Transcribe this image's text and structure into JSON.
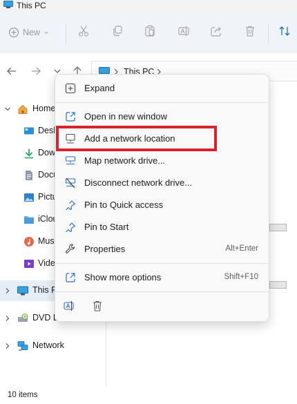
{
  "window": {
    "title": "This PC"
  },
  "command_bar": {
    "new_label": "New",
    "buttons": [
      "cut-icon",
      "copy-icon",
      "paste-icon",
      "rename-icon",
      "share-icon",
      "delete-icon",
      "sort-icon"
    ]
  },
  "navigation": {
    "breadcrumb": [
      "This PC"
    ]
  },
  "sidebar": {
    "items": [
      {
        "label": "Home",
        "icon": "home-icon"
      },
      {
        "label": "Desk",
        "icon": "desktop-folder-icon"
      },
      {
        "label": "Dow",
        "icon": "downloads-icon"
      },
      {
        "label": "Docu",
        "icon": "documents-icon"
      },
      {
        "label": "Pictu",
        "icon": "pictures-icon"
      },
      {
        "label": "iClou",
        "icon": "icloud-folder-icon"
      },
      {
        "label": "Musi",
        "icon": "music-icon"
      },
      {
        "label": "Vide",
        "icon": "videos-icon"
      },
      {
        "label": "This P",
        "icon": "this-pc-icon",
        "selected": true
      },
      {
        "label": "DVD D",
        "icon": "dvd-drive-icon"
      },
      {
        "label": "Network",
        "icon": "network-icon"
      }
    ]
  },
  "context_menu": {
    "items": [
      {
        "label": "Expand",
        "icon": "expand-icon"
      },
      {
        "label": "Open in new window",
        "icon": "open-new-window-icon"
      },
      {
        "label": "Add a network location",
        "icon": "network-location-icon",
        "highlighted": true
      },
      {
        "label": "Map network drive...",
        "icon": "map-network-drive-icon"
      },
      {
        "label": "Disconnect network drive...",
        "icon": "disconnect-drive-icon"
      },
      {
        "label": "Pin to Quick access",
        "icon": "pin-icon"
      },
      {
        "label": "Pin to Start",
        "icon": "pin-icon"
      },
      {
        "label": "Properties",
        "icon": "properties-icon",
        "shortcut": "Alt+Enter"
      },
      {
        "label": "Show more options",
        "icon": "show-more-options-icon",
        "shortcut": "Shift+F10"
      }
    ],
    "bottom_actions": [
      "rename-icon",
      "delete-icon"
    ],
    "highlight_color": "#d9232d"
  },
  "status_bar": {
    "item_count": "10 items"
  },
  "colors": {
    "accent": "#0067c0",
    "highlight": "#d9232d"
  }
}
